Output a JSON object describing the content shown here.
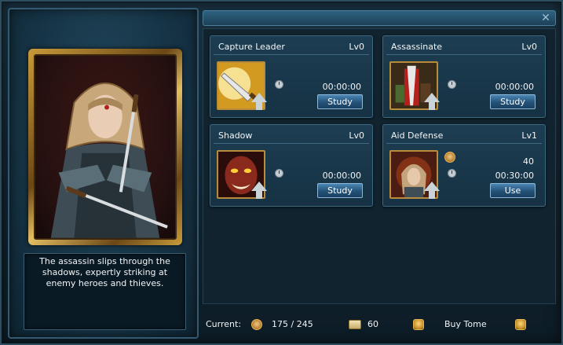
{
  "hero": {
    "description": "The assassin slips through the shadows, expertly striking at enemy heroes and thieves."
  },
  "skills": [
    {
      "name": "Capture Leader",
      "level": "Lv0",
      "time": "00:00:00",
      "button": "Study",
      "icon": "dagger-icon"
    },
    {
      "name": "Assassinate",
      "level": "Lv0",
      "time": "00:00:00",
      "button": "Study",
      "icon": "assassin-blade-icon"
    },
    {
      "name": "Shadow",
      "level": "Lv0",
      "time": "00:00:00",
      "button": "Study",
      "icon": "demon-face-icon"
    },
    {
      "name": "Aid Defense",
      "level": "Lv1",
      "count": "40",
      "time": "00:30:00",
      "button": "Use",
      "icon": "hooded-assassin-icon"
    }
  ],
  "footer": {
    "current_label": "Current:",
    "hero_count": "175 / 245",
    "scroll_count": "60",
    "buy_tome_label": "Buy Tome"
  },
  "colors": {
    "accent_gold": "#c79a3a",
    "button_blue": "#245277",
    "panel_bg": "#163244"
  }
}
